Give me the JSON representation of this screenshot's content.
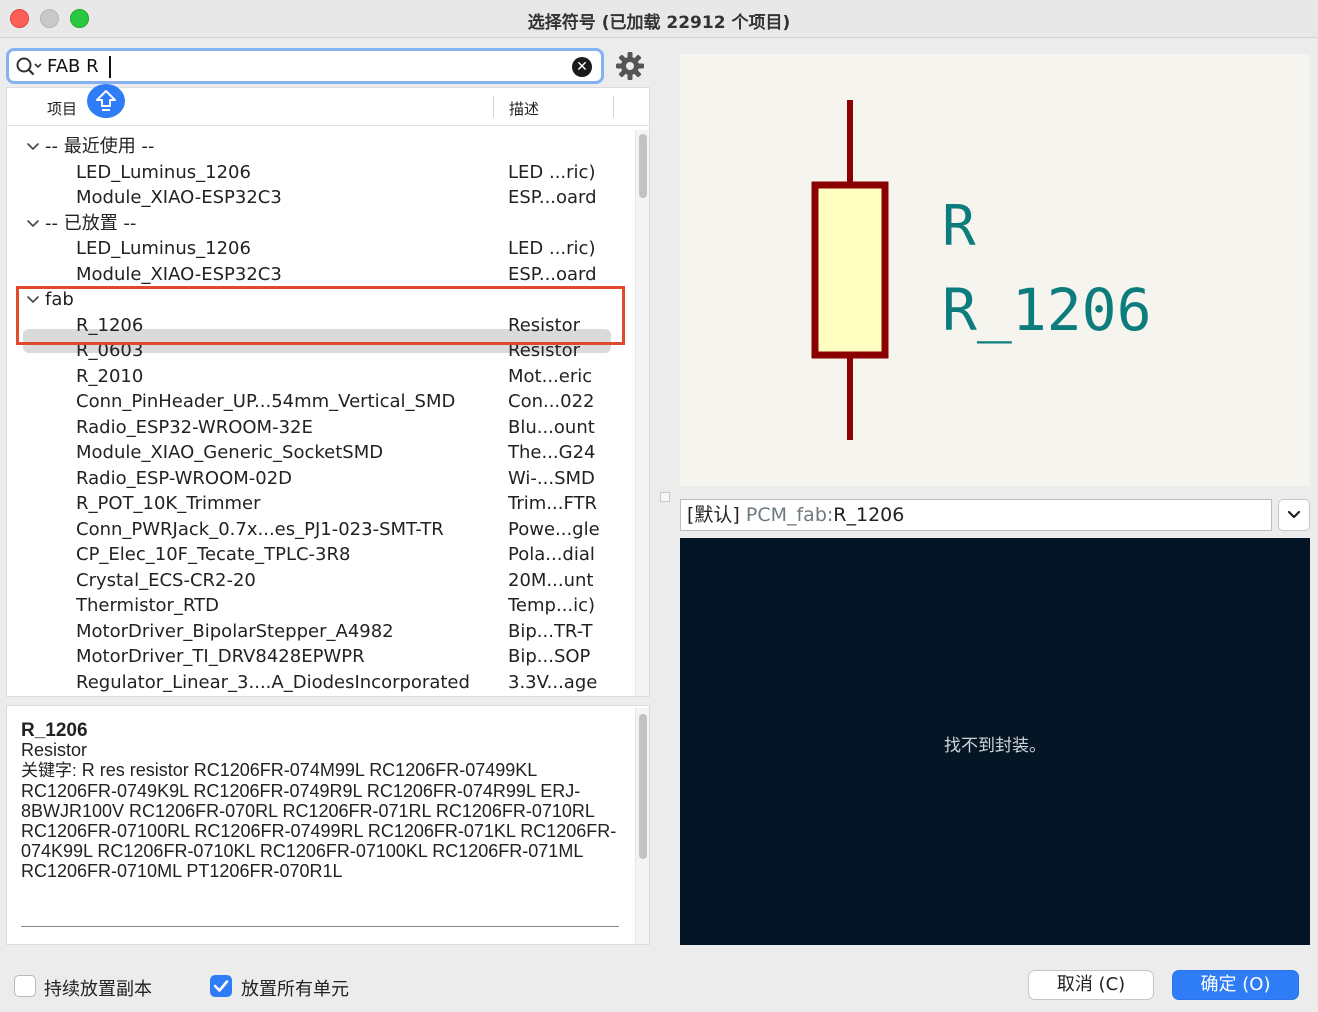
{
  "window": {
    "title": "选择符号 (已加载 22912 个项目)"
  },
  "search": {
    "value": "FAB R",
    "clear_glyph": "✕",
    "icon": "search-icon",
    "settings_icon": "gear-icon"
  },
  "tree": {
    "columns": [
      "项目",
      "描述"
    ],
    "rows": [
      {
        "type": "group",
        "name": "-- 最近使用 --",
        "desc": ""
      },
      {
        "type": "item",
        "name": "LED_Luminus_1206",
        "desc": "LED ...ric)"
      },
      {
        "type": "item",
        "name": "Module_XIAO-ESP32C3",
        "desc": "ESP...oard"
      },
      {
        "type": "group",
        "name": "-- 已放置 --",
        "desc": ""
      },
      {
        "type": "item",
        "name": "LED_Luminus_1206",
        "desc": "LED ...ric)"
      },
      {
        "type": "item",
        "name": "Module_XIAO-ESP32C3",
        "desc": "ESP...oard"
      },
      {
        "type": "group",
        "name": "fab",
        "desc": ""
      },
      {
        "type": "item",
        "name": "R_1206",
        "desc": "Resistor",
        "selected": true
      },
      {
        "type": "item",
        "name": "R_0603",
        "desc": "Resistor"
      },
      {
        "type": "item",
        "name": "R_2010",
        "desc": "Mot...eric"
      },
      {
        "type": "item",
        "name": "Conn_PinHeader_UP...54mm_Vertical_SMD",
        "desc": "Con...022"
      },
      {
        "type": "item",
        "name": "Radio_ESP32-WROOM-32E",
        "desc": "Blu...ount"
      },
      {
        "type": "item",
        "name": "Module_XIAO_Generic_SocketSMD",
        "desc": "The...G24"
      },
      {
        "type": "item",
        "name": "Radio_ESP-WROOM-02D",
        "desc": "Wi-...SMD"
      },
      {
        "type": "item",
        "name": "R_POT_10K_Trimmer",
        "desc": "Trim...FTR"
      },
      {
        "type": "item",
        "name": "Conn_PWRJack_0.7x...es_PJ1-023-SMT-TR",
        "desc": "Powe...gle"
      },
      {
        "type": "item",
        "name": "CP_Elec_10F_Tecate_TPLC-3R8",
        "desc": "Pola...dial"
      },
      {
        "type": "item",
        "name": "Crystal_ECS-CR2-20",
        "desc": "20M...unt"
      },
      {
        "type": "item",
        "name": "Thermistor_RTD",
        "desc": "Temp...ic)"
      },
      {
        "type": "item",
        "name": "MotorDriver_BipolarStepper_A4982",
        "desc": "Bip...TR-T"
      },
      {
        "type": "item",
        "name": "MotorDriver_TI_DRV8428EPWPR",
        "desc": "Bip...SOP"
      },
      {
        "type": "item",
        "name": "Regulator_Linear_3....A_DiodesIncorporated",
        "desc": "3.3V...age"
      }
    ]
  },
  "details": {
    "name": "R_1206",
    "description": "Resistor",
    "keywords_label": "关键字:",
    "keywords": "R res resistor RC1206FR-074M99L RC1206FR-07499KL RC1206FR-0749K9L RC1206FR-0749R9L RC1206FR-074R99L ERJ-8BWJR100V RC1206FR-070RL RC1206FR-071RL RC1206FR-0710RL RC1206FR-07100RL RC1206FR-07499RL RC1206FR-071KL RC1206FR-074K99L RC1206FR-0710KL RC1206FR-07100KL RC1206FR-071ML RC1206FR-0710ML PT1206FR-070R1L"
  },
  "symbol_preview": {
    "reference": "R",
    "value": "R_1206",
    "colors": {
      "body_stroke": "#8b0000",
      "body_fill": "#ffffc2",
      "text": "#0d7c7c",
      "background": "#f5f4ef"
    }
  },
  "footprint": {
    "tag": "[默认]",
    "library": "PCM_fab:",
    "name": "R_1206",
    "not_found": "找不到封装。"
  },
  "footer": {
    "keep_placing_label": "持续放置副本",
    "keep_placing_checked": false,
    "place_all_units_label": "放置所有单元",
    "place_all_units_checked": true,
    "cancel_label": "取消 (C)",
    "ok_label": "确定 (O)"
  }
}
